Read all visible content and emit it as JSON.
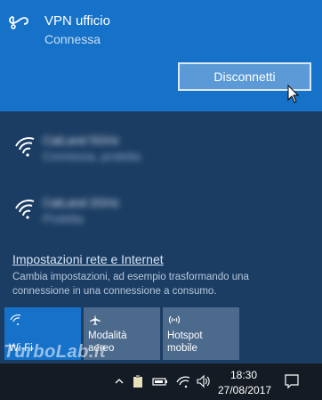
{
  "vpn": {
    "name": "VPN ufficio",
    "status": "Connessa",
    "disconnect_label": "Disconnetti"
  },
  "networks": [
    {
      "ssid": "CatLand 5GHz",
      "status": "Connessa, protetta"
    },
    {
      "ssid": "CatLand 2GHz",
      "status": "Protetta"
    }
  ],
  "settings": {
    "link": "Impostazioni rete e Internet",
    "description": "Cambia impostazioni, ad esempio trasformando una connessione in una connessione a consumo."
  },
  "quick_actions": [
    {
      "label": "Wi-Fi",
      "icon": "wifi-icon",
      "active": true
    },
    {
      "label": "Modalità aereo",
      "icon": "airplane-icon",
      "active": false
    },
    {
      "label": "Hotspot mobile",
      "icon": "hotspot-icon",
      "active": false
    }
  ],
  "taskbar": {
    "time": "18:30",
    "date": "27/08/2017"
  },
  "watermark": "TurboLab.it",
  "colors": {
    "accent": "#1672c9",
    "flyout_bg": "#1c3d63",
    "tile_inactive": "#4b6a8c",
    "taskbar": "#141b24"
  }
}
